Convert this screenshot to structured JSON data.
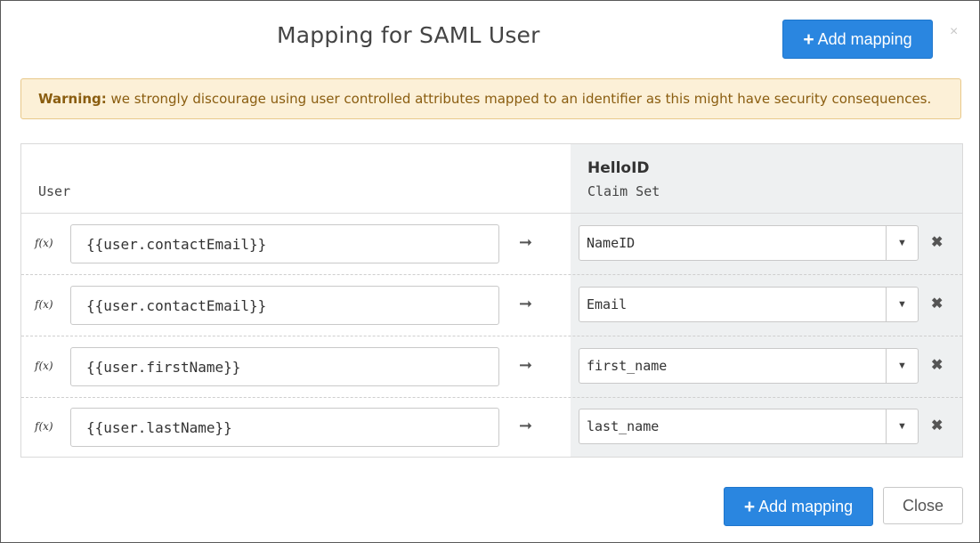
{
  "dialog": {
    "title": "Mapping for SAML User",
    "add_mapping_label": "Add mapping",
    "close_x": "×"
  },
  "warning": {
    "label": "Warning:",
    "text": " we strongly discourage using user controlled attributes mapped to an identifier as this might have security consequences."
  },
  "columns": {
    "left_header": "User",
    "right_title": "HelloID",
    "right_subtitle": "Claim Set"
  },
  "rows": [
    {
      "fx": "f(x)",
      "expression": "{{user.contactEmail}}",
      "arrow": "➞",
      "claim": "NameID",
      "caret": "▼",
      "remove": "✖"
    },
    {
      "fx": "f(x)",
      "expression": "{{user.contactEmail}}",
      "arrow": "➞",
      "claim": "Email",
      "caret": "▼",
      "remove": "✖"
    },
    {
      "fx": "f(x)",
      "expression": "{{user.firstName}}",
      "arrow": "➞",
      "claim": "first_name",
      "caret": "▼",
      "remove": "✖"
    },
    {
      "fx": "f(x)",
      "expression": "{{user.lastName}}",
      "arrow": "➞",
      "claim": "last_name",
      "caret": "▼",
      "remove": "✖"
    }
  ],
  "footer": {
    "add_mapping_label": "Add mapping",
    "close_label": "Close"
  },
  "colors": {
    "primary": "#2a86e0",
    "warning_bg": "#fcf0d7",
    "warning_text": "#8a5d10",
    "claim_bg": "#eef0f1"
  }
}
